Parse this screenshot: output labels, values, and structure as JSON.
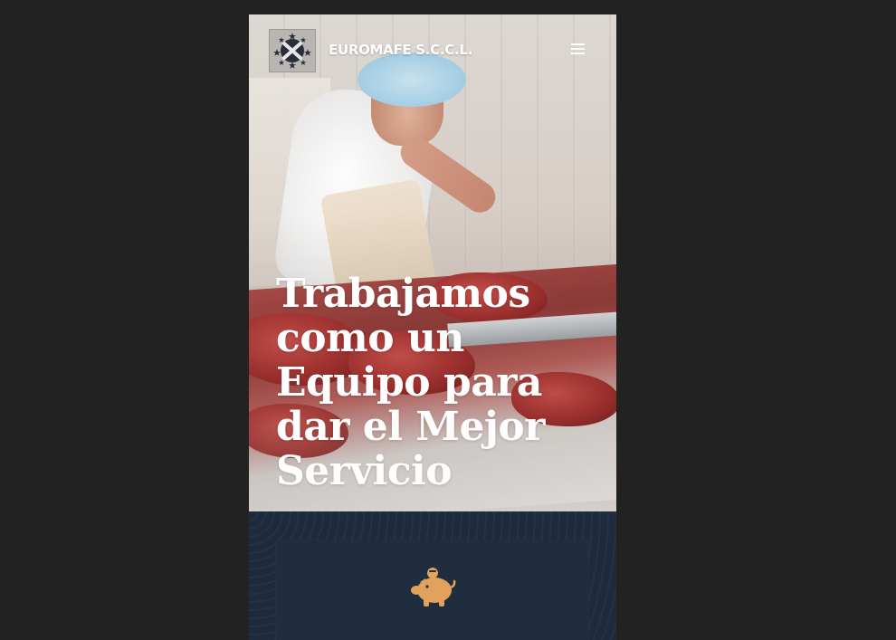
{
  "header": {
    "brand": "EUROMAFE S.C.C.L.",
    "logo_icon": "euromafe-logo-icon",
    "menu_icon": "hamburger-menu-icon"
  },
  "hero": {
    "title": "Trabajamos como un Equipo para dar el Mejor Servicio"
  },
  "feature": {
    "icon": "piggy-bank-icon",
    "icon_color": "#e0a25c"
  },
  "colors": {
    "page_background": "#222223",
    "section_background": "#1d2b3d",
    "accent": "#e0a25c"
  }
}
